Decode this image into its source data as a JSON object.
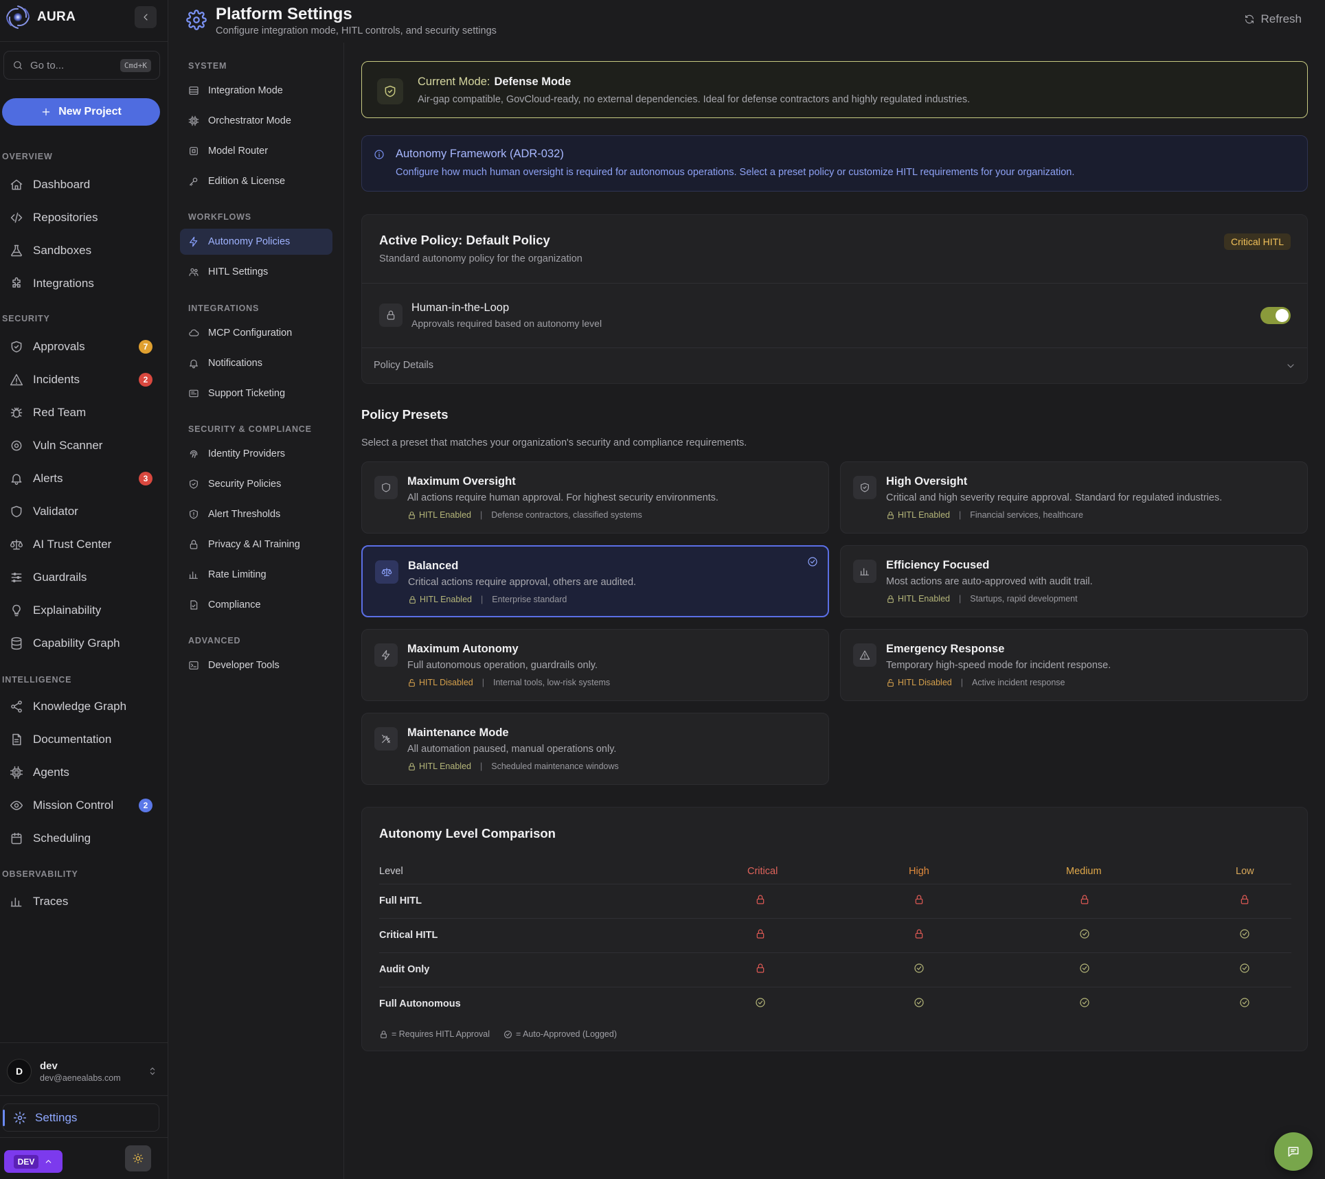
{
  "app": {
    "name": "AURA",
    "search_placeholder": "Go to...",
    "search_shortcut": "Cmd+K",
    "new_project": "New Project"
  },
  "sidebar": {
    "sections": {
      "overview": "OVERVIEW",
      "security": "SECURITY",
      "intelligence": "INTELLIGENCE",
      "observability": "OBSERVABILITY"
    },
    "items": [
      {
        "label": "Dashboard",
        "icon": "home-icon"
      },
      {
        "label": "Repositories",
        "icon": "code-icon"
      },
      {
        "label": "Sandboxes",
        "icon": "flask-icon"
      },
      {
        "label": "Integrations",
        "icon": "puzzle-icon"
      },
      {
        "label": "Approvals",
        "icon": "shield-check-icon",
        "badge": "7",
        "badge_color": "#e0a030"
      },
      {
        "label": "Incidents",
        "icon": "warning-icon",
        "badge": "2",
        "badge_color": "#d9483f"
      },
      {
        "label": "Red Team",
        "icon": "bug-icon"
      },
      {
        "label": "Vuln Scanner",
        "icon": "scan-icon"
      },
      {
        "label": "Alerts",
        "icon": "bell-icon",
        "badge": "3",
        "badge_color": "#d9483f"
      },
      {
        "label": "Validator",
        "icon": "shield-icon"
      },
      {
        "label": "AI Trust Center",
        "icon": "scale-icon"
      },
      {
        "label": "Guardrails",
        "icon": "sliders-icon"
      },
      {
        "label": "Explainability",
        "icon": "bulb-icon"
      },
      {
        "label": "Capability Graph",
        "icon": "database-icon"
      },
      {
        "label": "Knowledge Graph",
        "icon": "share-icon"
      },
      {
        "label": "Documentation",
        "icon": "document-icon"
      },
      {
        "label": "Agents",
        "icon": "cpu-icon"
      },
      {
        "label": "Mission Control",
        "icon": "eye-icon",
        "badge": "2",
        "badge_color": "#5b78e8"
      },
      {
        "label": "Scheduling",
        "icon": "calendar-icon"
      },
      {
        "label": "Traces",
        "icon": "bar-chart-icon"
      }
    ],
    "user": {
      "initial": "D",
      "name": "dev",
      "email": "dev@aenealabs.com"
    },
    "settings_label": "Settings",
    "env_badge": "DEV"
  },
  "header": {
    "title": "Platform Settings",
    "subtitle": "Configure integration mode, HITL controls, and security settings",
    "refresh": "Refresh"
  },
  "settings_nav": {
    "sections": {
      "system": "SYSTEM",
      "workflows": "WORKFLOWS",
      "integrations": "INTEGRATIONS",
      "security": "SECURITY & COMPLIANCE",
      "advanced": "ADVANCED"
    },
    "items": [
      {
        "label": "Integration Mode",
        "icon": "layers-icon"
      },
      {
        "label": "Orchestrator Mode",
        "icon": "cpu-icon"
      },
      {
        "label": "Model Router",
        "icon": "chip-icon"
      },
      {
        "label": "Edition & License",
        "icon": "key-icon"
      },
      {
        "label": "Autonomy Policies",
        "icon": "lightning-icon",
        "active": true
      },
      {
        "label": "HITL Settings",
        "icon": "users-icon"
      },
      {
        "label": "MCP Configuration",
        "icon": "cloud-icon"
      },
      {
        "label": "Notifications",
        "icon": "bell-icon"
      },
      {
        "label": "Support Ticketing",
        "icon": "ticket-icon"
      },
      {
        "label": "Identity Providers",
        "icon": "fingerprint-icon"
      },
      {
        "label": "Security Policies",
        "icon": "shield-check-icon"
      },
      {
        "label": "Alert Thresholds",
        "icon": "shield-alert-icon"
      },
      {
        "label": "Privacy & AI Training",
        "icon": "lock-icon"
      },
      {
        "label": "Rate Limiting",
        "icon": "bar-chart-icon"
      },
      {
        "label": "Compliance",
        "icon": "file-check-icon"
      },
      {
        "label": "Developer Tools",
        "icon": "terminal-icon"
      }
    ]
  },
  "mode_banner": {
    "label": "Current Mode:",
    "value": "Defense Mode",
    "description": "Air-gap compatible, GovCloud-ready, no external dependencies. Ideal for defense contractors and highly regulated industries."
  },
  "framework_info": {
    "title": "Autonomy Framework (ADR-032)",
    "description": "Configure how much human oversight is required for autonomous operations. Select a preset policy or customize HITL requirements for your organization."
  },
  "active_policy": {
    "title": "Active Policy: Default Policy",
    "subtitle": "Standard autonomy policy for the organization",
    "badge": "Critical HITL",
    "hitl_title": "Human-in-the-Loop",
    "hitl_subtitle": "Approvals required based on autonomy level",
    "hitl_enabled": true,
    "details_label": "Policy Details"
  },
  "presets": {
    "title": "Policy Presets",
    "subtitle": "Select a preset that matches your organization's security and compliance requirements.",
    "items": [
      {
        "title": "Maximum Oversight",
        "desc": "All actions require human approval. For highest security environments.",
        "hitl": "HITL Enabled",
        "hitl_on": true,
        "audience": "Defense contractors, classified systems",
        "icon": "shield-icon"
      },
      {
        "title": "High Oversight",
        "desc": "Critical and high severity require approval. Standard for regulated industries.",
        "hitl": "HITL Enabled",
        "hitl_on": true,
        "audience": "Financial services, healthcare",
        "icon": "shield-check-icon"
      },
      {
        "title": "Balanced",
        "desc": "Critical actions require approval, others are audited.",
        "hitl": "HITL Enabled",
        "hitl_on": true,
        "audience": "Enterprise standard",
        "icon": "scale-icon",
        "selected": true
      },
      {
        "title": "Efficiency Focused",
        "desc": "Most actions are auto-approved with audit trail.",
        "hitl": "HITL Enabled",
        "hitl_on": true,
        "audience": "Startups, rapid development",
        "icon": "bar-chart-icon"
      },
      {
        "title": "Maximum Autonomy",
        "desc": "Full autonomous operation, guardrails only.",
        "hitl": "HITL Disabled",
        "hitl_on": false,
        "audience": "Internal tools, low-risk systems",
        "icon": "lightning-icon"
      },
      {
        "title": "Emergency Response",
        "desc": "Temporary high-speed mode for incident response.",
        "hitl": "HITL Disabled",
        "hitl_on": false,
        "audience": "Active incident response",
        "icon": "warning-icon"
      },
      {
        "title": "Maintenance Mode",
        "desc": "All automation paused, manual operations only.",
        "hitl": "HITL Enabled",
        "hitl_on": true,
        "audience": "Scheduled maintenance windows",
        "icon": "tools-icon"
      }
    ]
  },
  "comparison": {
    "title": "Autonomy Level Comparison",
    "level_header": "Level",
    "columns": [
      {
        "label": "Critical",
        "color": "#e0645c"
      },
      {
        "label": "High",
        "color": "#e08a3c"
      },
      {
        "label": "Medium",
        "color": "#e0a84a"
      },
      {
        "label": "Low",
        "color": "#d8a85a"
      }
    ],
    "rows": [
      {
        "label": "Full HITL",
        "cells": [
          "lock",
          "lock",
          "lock",
          "lock"
        ]
      },
      {
        "label": "Critical HITL",
        "cells": [
          "lock",
          "lock",
          "ok",
          "ok"
        ]
      },
      {
        "label": "Audit Only",
        "cells": [
          "lock",
          "ok",
          "ok",
          "ok"
        ]
      },
      {
        "label": "Full Autonomous",
        "cells": [
          "ok",
          "ok",
          "ok",
          "ok"
        ]
      }
    ],
    "legend_lock": "= Requires HITL Approval",
    "legend_ok": "= Auto-Approved (Logged)"
  }
}
